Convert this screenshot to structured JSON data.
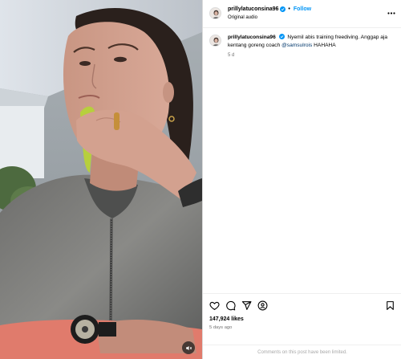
{
  "header": {
    "username": "prillylatuconsina96",
    "separator": "•",
    "follow_label": "Follow",
    "audio_label": "Original audio"
  },
  "caption": {
    "username": "prillylatuconsina96",
    "text_before_mention": "Nyemil abis training freediving. Anggap aja kentang goreng coach",
    "mention": "@samsulrois",
    "text_after_mention": "HAHAHA",
    "time": "5 d"
  },
  "actions": {
    "icons": [
      "heart-icon",
      "comment-icon",
      "share-icon",
      "remix-icon",
      "bookmark-icon"
    ],
    "likes": "147,924 likes",
    "posted_ago": "5 days ago"
  },
  "footer": {
    "comments_notice": "Comments on this post have been limited."
  },
  "colors": {
    "follow": "#0095f6",
    "verified": "#0095f6",
    "mention": "#00376b",
    "muted_text": "#737373"
  }
}
